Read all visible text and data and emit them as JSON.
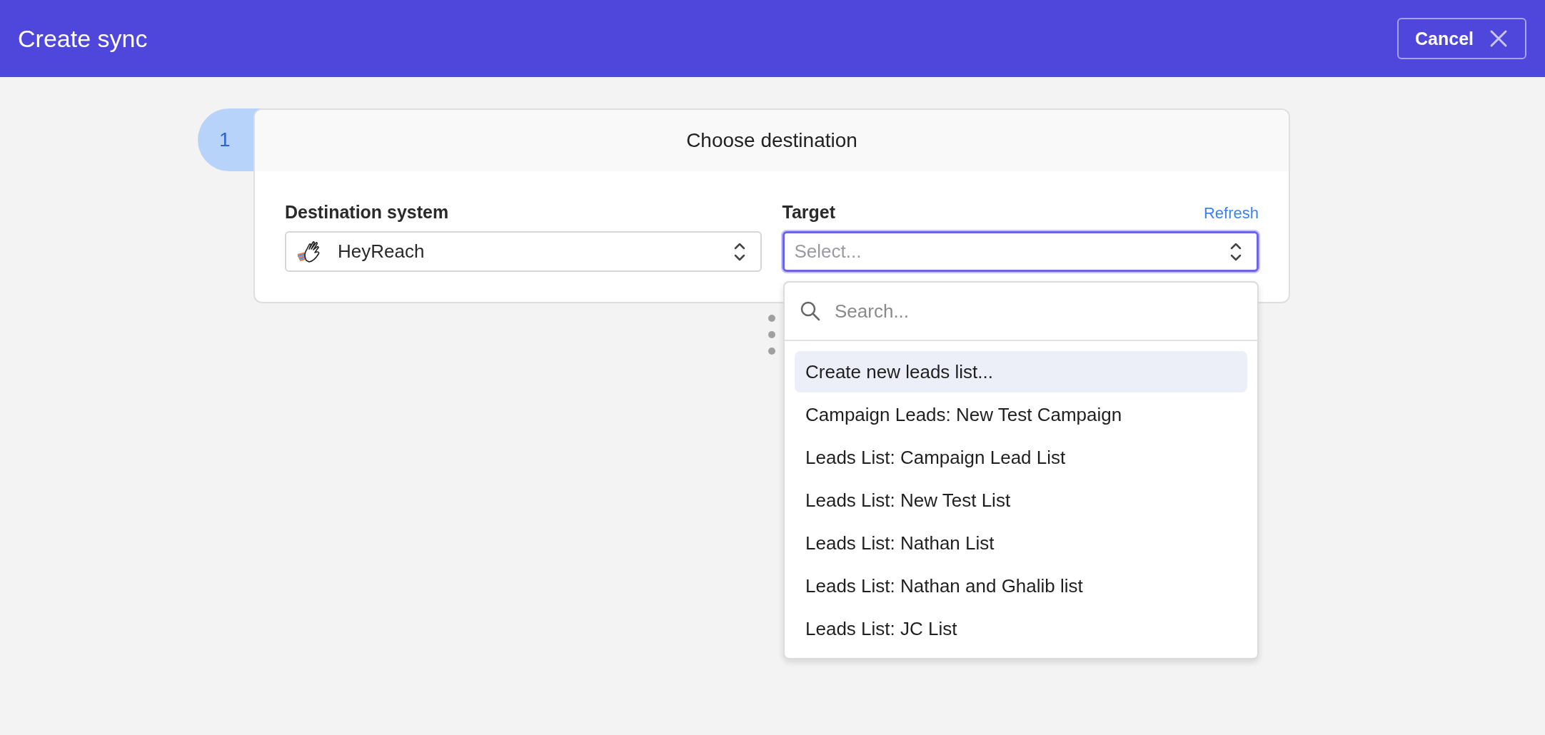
{
  "header": {
    "title": "Create sync",
    "cancel_button": "Cancel"
  },
  "step": {
    "number": "1",
    "title": "Choose destination"
  },
  "destination_field": {
    "label": "Destination system",
    "value": "HeyReach"
  },
  "target_field": {
    "label": "Target",
    "refresh_link": "Refresh",
    "placeholder": "Select...",
    "focused": true
  },
  "dropdown": {
    "search_placeholder": "Search...",
    "options": [
      {
        "label": "Create new leads list...",
        "selected": true
      },
      {
        "label": "Campaign Leads: New Test Campaign",
        "selected": false
      },
      {
        "label": "Leads List: Campaign Lead List",
        "selected": false
      },
      {
        "label": "Leads List: New Test List",
        "selected": false
      },
      {
        "label": "Leads List: Nathan List",
        "selected": false
      },
      {
        "label": "Leads List: Nathan and Ghalib list",
        "selected": false
      },
      {
        "label": "Leads List: JC List",
        "selected": false
      }
    ]
  }
}
